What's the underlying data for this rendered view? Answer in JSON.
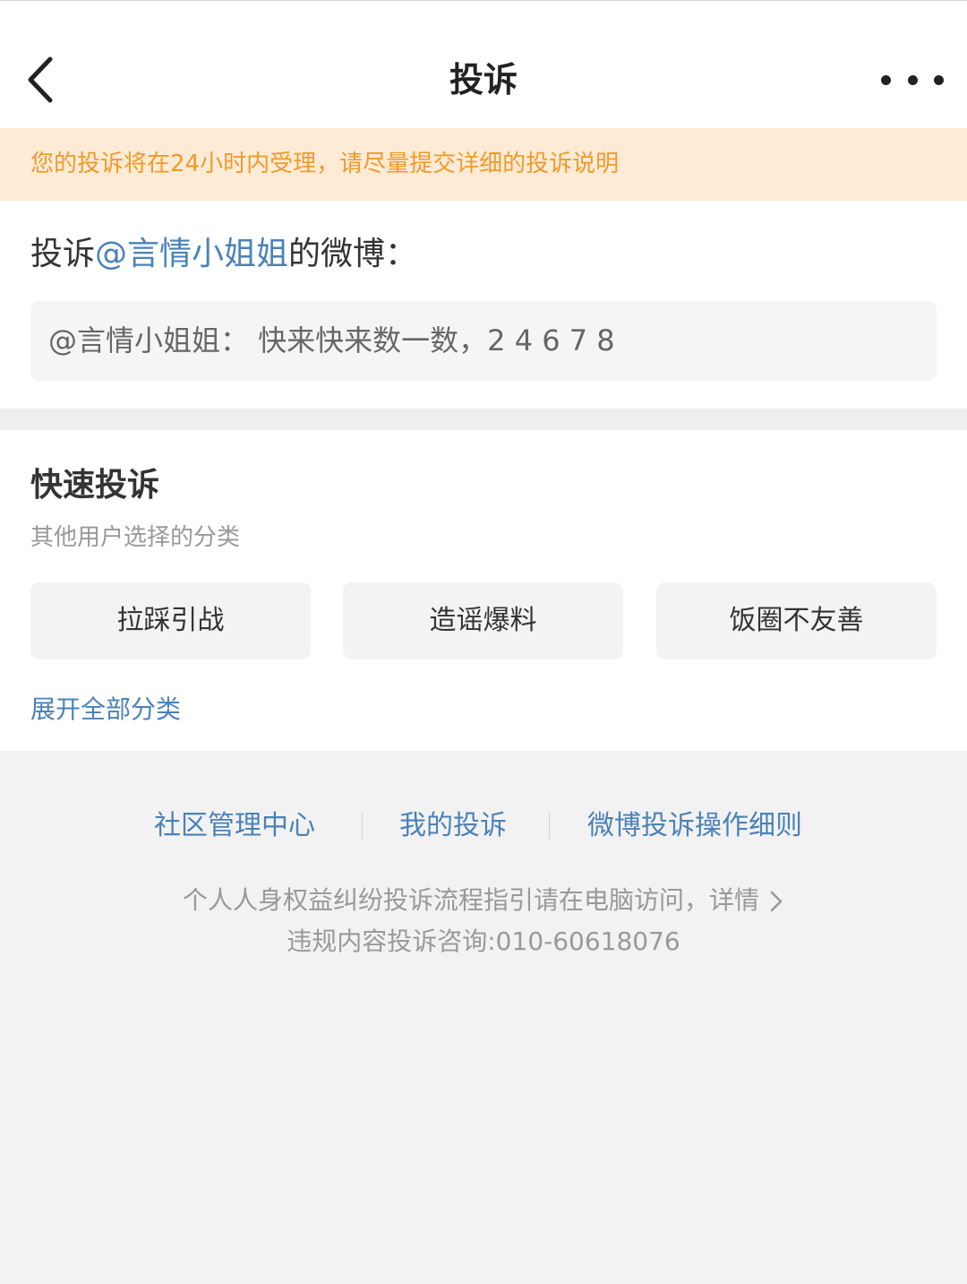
{
  "header": {
    "title": "投诉",
    "back_icon": "chevron-left-icon",
    "more_icon": "more-dots-icon"
  },
  "notice": {
    "text": "您的投诉将在24小时内受理，请尽量提交详细的投诉说明",
    "color": "#f09a2a",
    "background": "#fdebd6"
  },
  "target": {
    "prefix": "投诉",
    "mention": "@言情小姐姐",
    "suffix": "的微博：",
    "quote": "@言情小姐姐： 快来快来数一数，2 4 6 7 8"
  },
  "quick": {
    "title": "快速投诉",
    "subtitle": "其他用户选择的分类",
    "options": [
      "拉踩引战",
      "造谣爆料",
      "饭圈不友善"
    ],
    "expand_label": "展开全部分类"
  },
  "footer": {
    "links": [
      "社区管理中心",
      "我的投诉",
      "微博投诉操作细则"
    ],
    "info_line1": "个人人身权益纠纷投诉流程指引请在电脑访问，详情",
    "info_line2": "违规内容投诉咨询:010-60618076",
    "detail_icon": "chevron-right-icon"
  },
  "colors": {
    "link": "#4a82b8",
    "text": "#333333",
    "muted": "#999999",
    "page_bg": "#f2f2f2"
  }
}
